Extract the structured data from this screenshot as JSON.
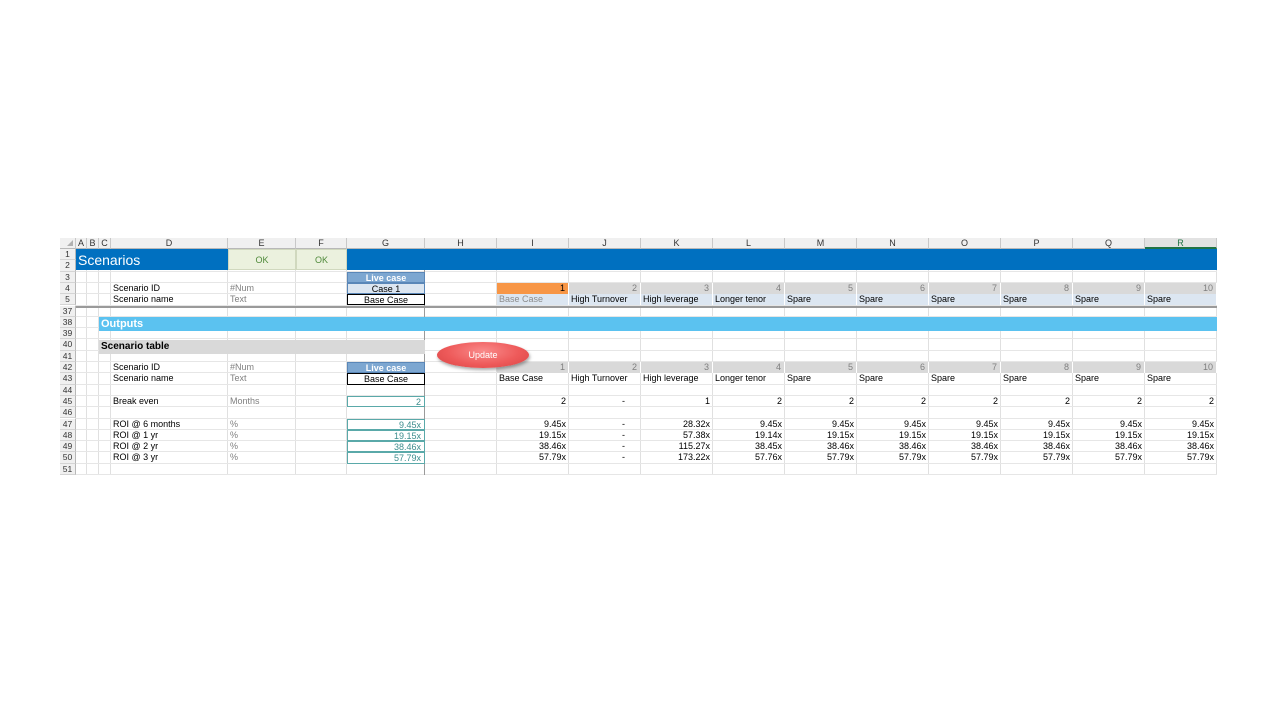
{
  "columns": [
    "A",
    "B",
    "C",
    "D",
    "E",
    "F",
    "G",
    "H",
    "I",
    "J",
    "K",
    "L",
    "M",
    "N",
    "O",
    "P",
    "Q",
    "R"
  ],
  "selected_column": "R",
  "rows": [
    "1",
    "2",
    "3",
    "4",
    "5",
    "37",
    "38",
    "39",
    "40",
    "41",
    "42",
    "43",
    "44",
    "45",
    "46",
    "47",
    "48",
    "49",
    "50",
    "51"
  ],
  "title": "Scenarios",
  "ok_labels": [
    "OK",
    "OK"
  ],
  "live_case_label": "Live case",
  "live_case_id": "Case 1",
  "live_case_name": "Base Case",
  "scenario_id_label": "Scenario ID",
  "scenario_name_label": "Scenario name",
  "num_unit": "#Num",
  "text_unit": "Text",
  "scenario_ids": [
    "1",
    "2",
    "3",
    "4",
    "5",
    "6",
    "7",
    "8",
    "9",
    "10"
  ],
  "scenario_names": [
    "Base Case",
    "High Turnover",
    "High leverage",
    "Longer tenor",
    "Spare",
    "Spare",
    "Spare",
    "Spare",
    "Spare",
    "Spare"
  ],
  "outputs_label": "Outputs",
  "scenario_table_label": "Scenario table",
  "update_button": "Update",
  "breakeven_label": "Break even",
  "breakeven_unit": "Months",
  "breakeven_live": "2",
  "breakeven_values": [
    "2",
    "-",
    "1",
    "2",
    "2",
    "2",
    "2",
    "2",
    "2",
    "2"
  ],
  "roi_unit": "%",
  "roi_rows": [
    {
      "label": "ROI @ 6 months",
      "live": "9.45x",
      "values": [
        "9.45x",
        "-",
        "28.32x",
        "9.45x",
        "9.45x",
        "9.45x",
        "9.45x",
        "9.45x",
        "9.45x",
        "9.45x"
      ]
    },
    {
      "label": "ROI @ 1 yr",
      "live": "19.15x",
      "values": [
        "19.15x",
        "-",
        "57.38x",
        "19.14x",
        "19.15x",
        "19.15x",
        "19.15x",
        "19.15x",
        "19.15x",
        "19.15x"
      ]
    },
    {
      "label": "ROI @ 2 yr",
      "live": "38.46x",
      "values": [
        "38.46x",
        "-",
        "115.27x",
        "38.45x",
        "38.46x",
        "38.46x",
        "38.46x",
        "38.46x",
        "38.46x",
        "38.46x"
      ]
    },
    {
      "label": "ROI @ 3 yr",
      "live": "57.79x",
      "values": [
        "57.79x",
        "-",
        "173.22x",
        "57.76x",
        "57.79x",
        "57.79x",
        "57.79x",
        "57.79x",
        "57.79x",
        "57.79x"
      ]
    }
  ],
  "colors": {
    "title_band": "#0070c0",
    "outputs_band": "#5bc2f0",
    "active_case": "#f79646",
    "header_blue": "#dce6f1",
    "live_header": "#7da7d1",
    "update_button": "#ee5a5a"
  }
}
